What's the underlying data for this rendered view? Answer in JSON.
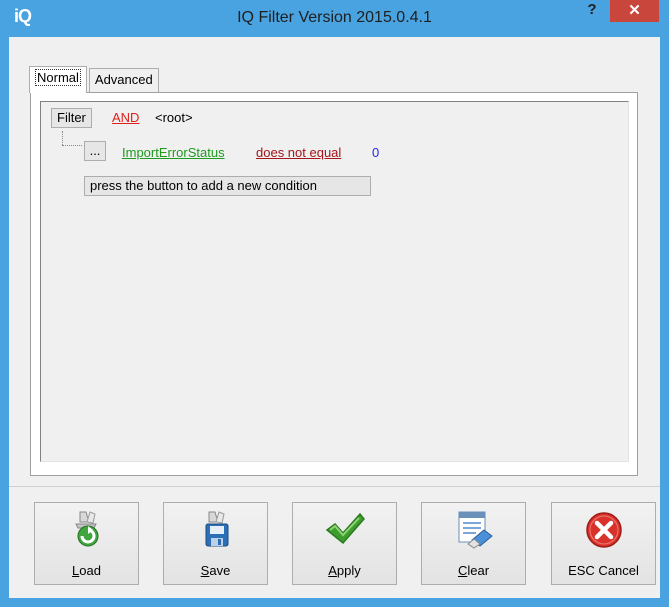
{
  "window": {
    "title": "IQ Filter Version 2015.0.4.1",
    "logo": "iQ",
    "help_label": "?",
    "close_label": "✕"
  },
  "tabs": [
    {
      "label": "Normal",
      "active": true
    },
    {
      "label": "Advanced",
      "active": false
    }
  ],
  "filter": {
    "filter_button": "Filter",
    "operator": "AND",
    "root_label": "<root>",
    "condition": {
      "options_button": "...",
      "field": "ImportErrorStatus",
      "comparison": "does not equal",
      "value": "0"
    },
    "add_condition_button": "press the button to add a new condition"
  },
  "buttons": [
    {
      "label": "Load",
      "icon": "load-icon"
    },
    {
      "label": "Save",
      "icon": "save-icon"
    },
    {
      "label": "Apply",
      "icon": "checkmark-icon"
    },
    {
      "label": "Clear",
      "icon": "clear-icon"
    },
    {
      "label": "ESC Cancel",
      "icon": "cancel-icon"
    }
  ],
  "colors": {
    "titlebar": "#49a3e0",
    "close": "#c9463d",
    "operator": "#e0201c",
    "field": "#1e9a1e",
    "comparison": "#a3151a",
    "value": "#1f2bf0"
  }
}
